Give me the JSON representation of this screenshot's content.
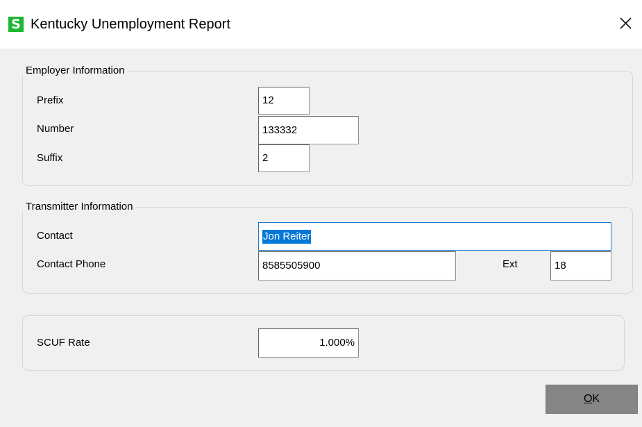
{
  "window": {
    "title": "Kentucky Unemployment Report",
    "app_icon_letter": "S",
    "app_icon_color": "#1db733"
  },
  "employer": {
    "legend": "Employer Information",
    "prefix_label": "Prefix",
    "prefix_value": "12",
    "number_label": "Number",
    "number_value": "133332",
    "suffix_label": "Suffix",
    "suffix_value": "2"
  },
  "transmitter": {
    "legend": "Transmitter Information",
    "contact_label": "Contact",
    "contact_value": "Jon Reiter",
    "phone_label": "Contact Phone",
    "phone_value": "8585505900",
    "ext_label": "Ext",
    "ext_value": "18"
  },
  "scuf": {
    "label": "SCUF Rate",
    "value": "1.000%"
  },
  "buttons": {
    "ok_label_underlined": "O",
    "ok_label_rest": "K"
  },
  "colors": {
    "selection": "#0078d7",
    "focus_border": "#1979ca",
    "ok_button": "#858585"
  }
}
